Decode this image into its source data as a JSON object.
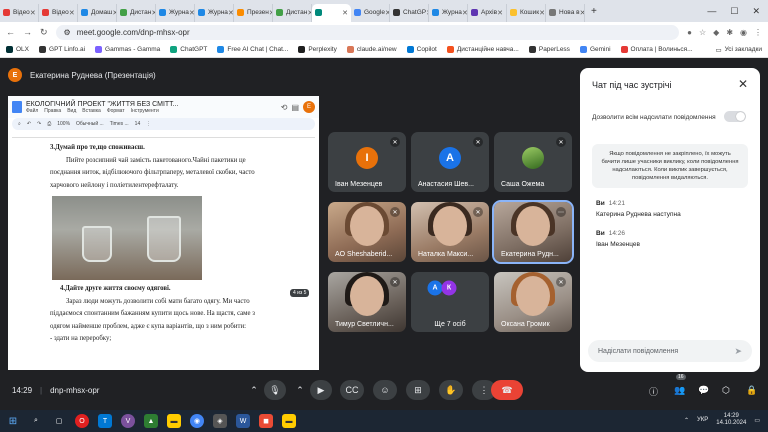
{
  "browser": {
    "tabs": [
      {
        "label": "Відео",
        "color": "#e53935"
      },
      {
        "label": "Відео",
        "color": "#e53935"
      },
      {
        "label": "Домаш",
        "color": "#1e88e5"
      },
      {
        "label": "Дистан",
        "color": "#43a047"
      },
      {
        "label": "Журна",
        "color": "#1e88e5"
      },
      {
        "label": "Журна",
        "color": "#1e88e5"
      },
      {
        "label": "Презен",
        "color": "#fb8c00"
      },
      {
        "label": "Дистан",
        "color": "#43a047"
      },
      {
        "label": "",
        "color": "#00897b",
        "active": true
      },
      {
        "label": "Google",
        "color": "#4285f4"
      },
      {
        "label": "ChatGP",
        "color": "#333333"
      },
      {
        "label": "Журна",
        "color": "#1e88e5"
      },
      {
        "label": "Архів",
        "color": "#5e35b1"
      },
      {
        "label": "Кошик",
        "color": "#fbc02d"
      },
      {
        "label": "Нова в",
        "color": "#777777"
      }
    ],
    "url": "meet.google.com/dnp-mhsx-opr",
    "bookmarks": [
      {
        "label": "OLX",
        "color": "#002f34"
      },
      {
        "label": "GPT Linfo.ai",
        "color": "#333333"
      },
      {
        "label": "Gammas - Gamma",
        "color": "#7b61ff"
      },
      {
        "label": "ChatGPT",
        "color": "#10a37f"
      },
      {
        "label": "Free AI Chat | Chat...",
        "color": "#1e88e5"
      },
      {
        "label": "Perplexity",
        "color": "#1f1f1f"
      },
      {
        "label": "claude.ai/new",
        "color": "#d97757"
      },
      {
        "label": "Copilot",
        "color": "#0078d4"
      },
      {
        "label": "Дистанційне навча...",
        "color": "#f4511e"
      },
      {
        "label": "PaperLess",
        "color": "#333333"
      },
      {
        "label": "Gemini",
        "color": "#4285f4"
      },
      {
        "label": "Оплата | Волинься...",
        "color": "#e53935"
      }
    ],
    "all_bookmarks": "Усі закладки"
  },
  "meet": {
    "presenter": {
      "initial": "Е",
      "label": "Екатерина Руднева (Презентація)",
      "color": "#e8710a"
    },
    "doc": {
      "title": "ЕКОЛОГІЧНИЙ ПРОЕКТ \"ЖИТТЯ БЕЗ СМІТТ...",
      "menu": [
        "Файл",
        "Правка",
        "Вид",
        "Вставка",
        "Формат",
        "Інструменти"
      ],
      "zoom": "100%",
      "style": "Обычный ...",
      "font": "Times ...",
      "size": "14",
      "lines": [
        "3.Думай про те,що споживаєш.",
        "Пийте розсипний чай замість пакетованого.Чайні пакетики це",
        "поєднання ниток, відбілюючого фільтрпаперу, металевої скобки, часто",
        "харчового нейлону і поліетилентерефталату."
      ],
      "lines2": [
        "4.Дайте друге життя своєму одягові.",
        "Зараз люди можуть дозволити собі мати багато одягу. Ми часто",
        "піддаємося спонтанним бажанням купити щось нове. На щастя, саме з",
        "одягом найменше проблем, адже є купа варіантів, що з ним робити:",
        "-     здати на переробку;"
      ],
      "page_badge": "4 из 5"
    },
    "tiles": [
      {
        "name": "Іван Мезенцев",
        "initial": "І",
        "color": "#e8710a"
      },
      {
        "name": "Анастасия Шев...",
        "initial": "А",
        "color": "#1a73e8"
      },
      {
        "name": "Саша Ожема",
        "initial": "",
        "color": "#5f6368"
      },
      {
        "name": "AO Sheshaberid...",
        "initial": "",
        "color": ""
      },
      {
        "name": "Наталка Макси...",
        "initial": "",
        "color": ""
      },
      {
        "name": "Екатерина Рудн...",
        "initial": "",
        "color": ""
      },
      {
        "name": "Тимур Светличн...",
        "initial": "",
        "color": ""
      },
      {
        "name": "Ще 7 осіб",
        "initial": "",
        "color": ""
      },
      {
        "name": "Оксана Громик",
        "initial": "",
        "color": ""
      }
    ],
    "others": [
      {
        "initial": "А",
        "color": "#1a73e8"
      },
      {
        "initial": "К",
        "color": "#9334e6"
      }
    ],
    "chat": {
      "title": "Чат під час зустрічі",
      "permission": "Дозволити всім надсилати повідомлення",
      "note": "Якщо повідомлення не закріплено, їх можуть бачити лише учасники виклику, коли повідомлення надсилаються. Коли виклик завершується, повідомлення видаляються.",
      "messages": [
        {
          "author": "Ви",
          "time": "14:21",
          "text": "Катерина Руднева наступна"
        },
        {
          "author": "Ви",
          "time": "14:26",
          "text": "Іван Мезенцев"
        }
      ],
      "input_placeholder": "Надіслати повідомлення"
    },
    "time": "14:29",
    "meeting_code": "dnp-mhsx-opr",
    "participants_count": "16"
  },
  "taskbar": {
    "lang": "УКР",
    "time": "14:29",
    "date": "14.10.2024"
  }
}
